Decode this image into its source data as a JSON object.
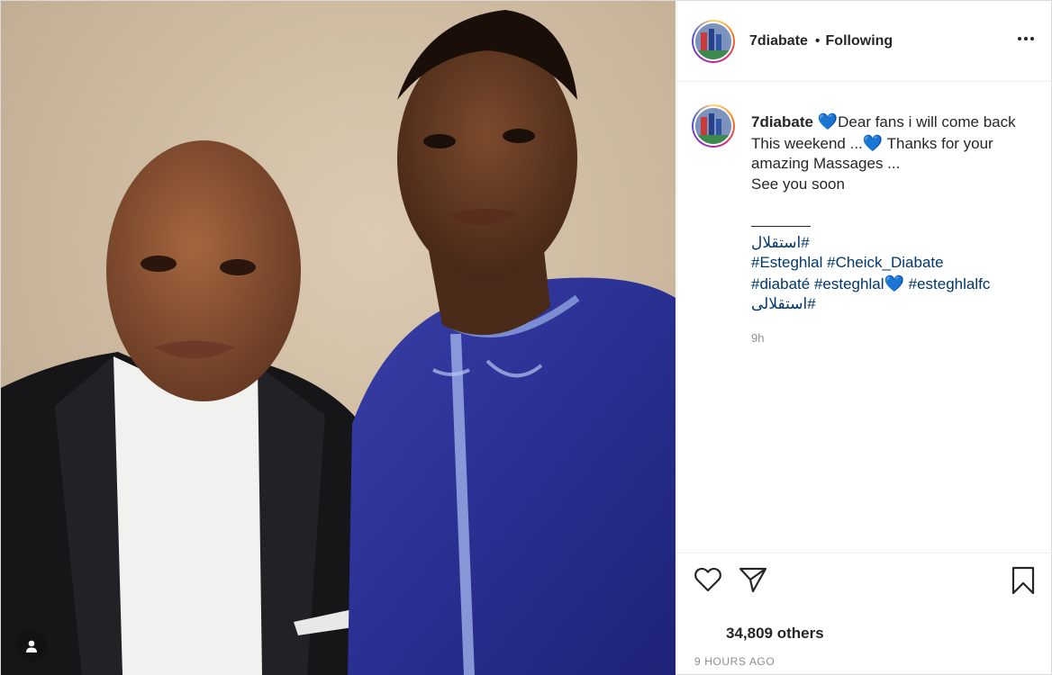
{
  "post": {
    "username": "7diabate",
    "separator": "•",
    "follow_status": "Following",
    "caption": {
      "username": "7diabate",
      "heart_1": "💙",
      "line_1": "Dear fans i will come back",
      "line_2_a": "This weekend ...",
      "heart_2": "💙",
      "line_2_b": " Thanks for your",
      "line_3": "amazing Massages ...",
      "line_4": "See you soon",
      "hashtags_1": "#استقلال",
      "hashtag_esteghlal": "#Esteghlal",
      "hashtag_cheick": "#Cheick_Diabate",
      "hashtag_diabate": "#diabaté",
      "hashtag_esteghlal_lower": "#esteghlal",
      "heart_3": "💙",
      "hashtag_esteghlalfc": "#esteghlalfc",
      "hashtags_last": "#استقلالی"
    },
    "comment_time": "9h",
    "likes_text": "34,809 others",
    "timestamp": "9 hours ago"
  },
  "icons": {
    "like": "heart-outline-icon",
    "share": "paper-plane-icon",
    "save": "bookmark-icon",
    "more": "more-options-icon",
    "user_tag": "user-icon"
  },
  "colors": {
    "hashtag": "#00376b",
    "heart_emoji": "#1fb7e6",
    "muted": "#8e8e8e",
    "text": "#262626"
  }
}
